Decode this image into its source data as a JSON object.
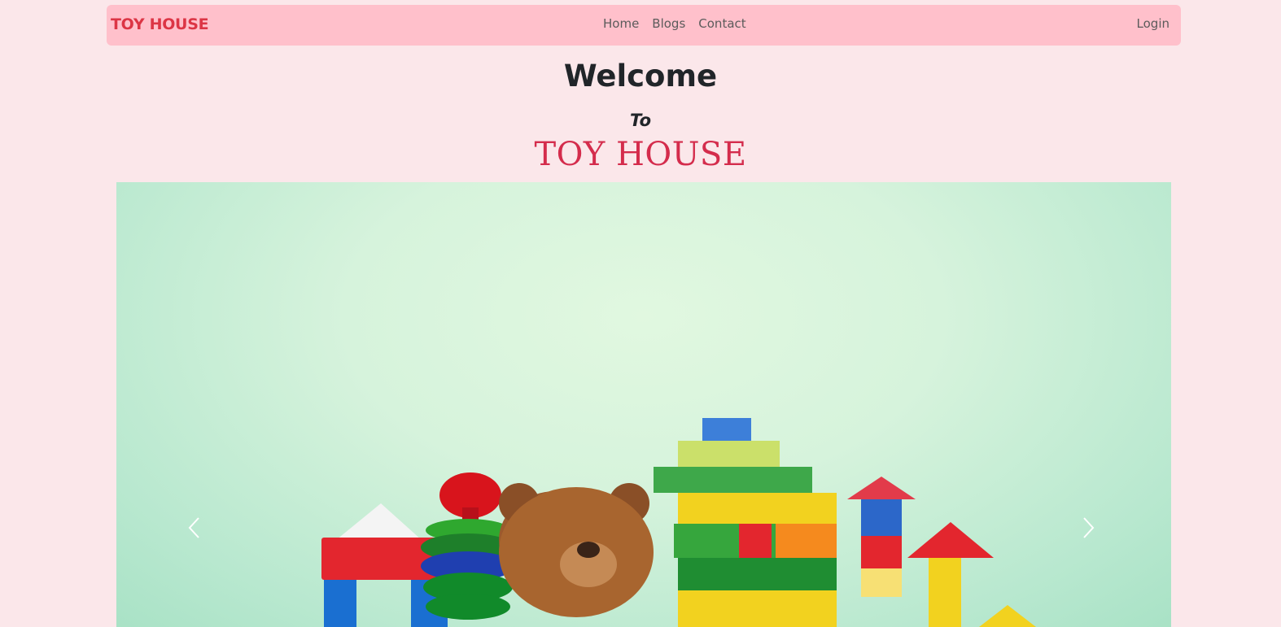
{
  "navbar": {
    "brand": "TOY HOUSE",
    "links": [
      "Home",
      "Blogs",
      "Contact"
    ],
    "login": "Login"
  },
  "hero": {
    "welcome": "Welcome",
    "to": "To",
    "title": "TOY HOUSE"
  },
  "carousel": {
    "prev_icon": "chevron-left-icon",
    "next_icon": "chevron-right-icon"
  },
  "colors": {
    "page_bg": "#fbe7ea",
    "navbar_bg": "#ffc0cb",
    "brand": "#dc3545",
    "title": "#d42c4c"
  }
}
